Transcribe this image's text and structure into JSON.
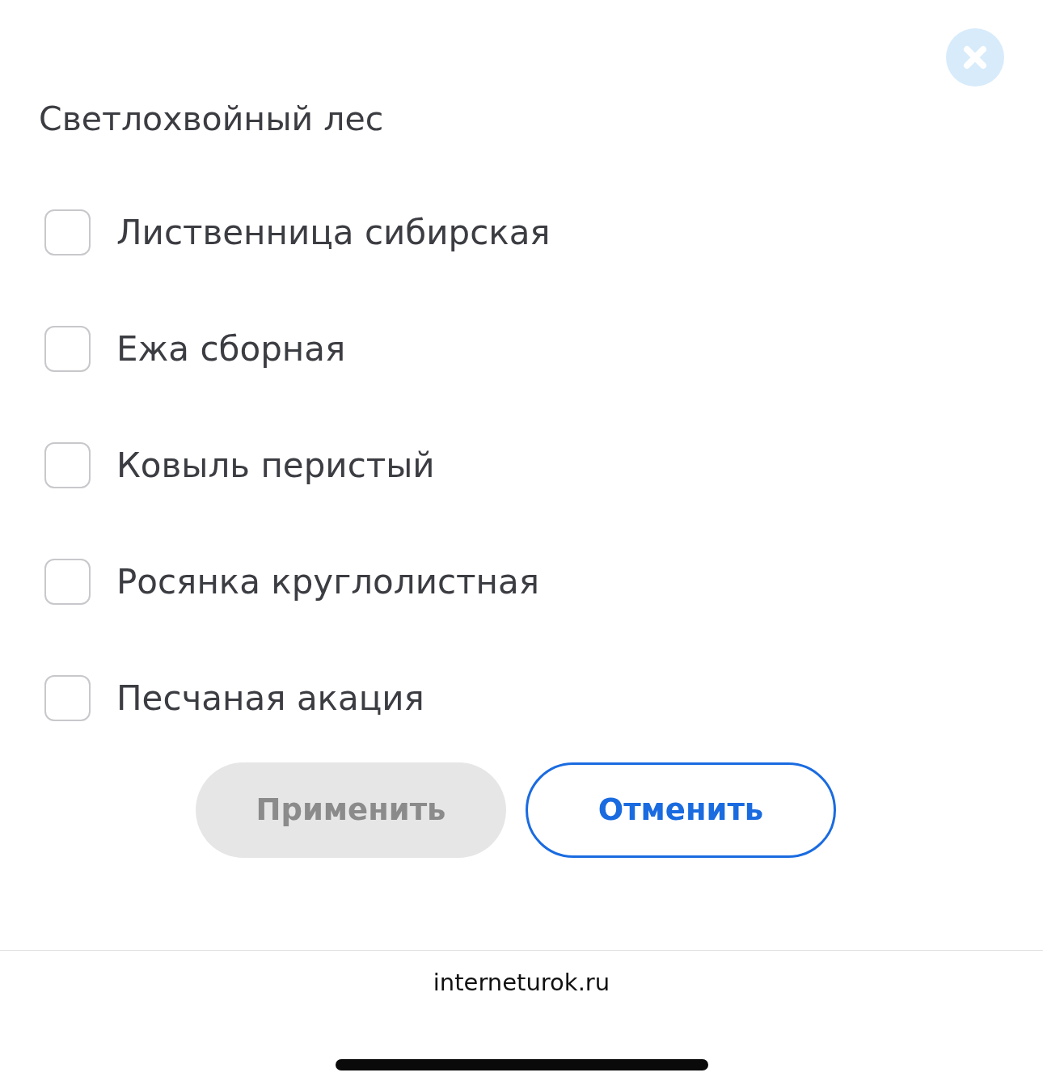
{
  "title": "Светлохвойный лес",
  "options": [
    {
      "label": "Лиственница сибирская",
      "checked": false
    },
    {
      "label": "Ежа сборная",
      "checked": false
    },
    {
      "label": "Ковыль перистый",
      "checked": false
    },
    {
      "label": "Росянка круглолистная",
      "checked": false
    },
    {
      "label": "Песчаная акация",
      "checked": false
    }
  ],
  "buttons": [
    {
      "label": "Применить",
      "disabled": true
    },
    {
      "label": "Отменить",
      "disabled": false
    }
  ],
  "footer": {
    "url": "interneturok.ru"
  }
}
